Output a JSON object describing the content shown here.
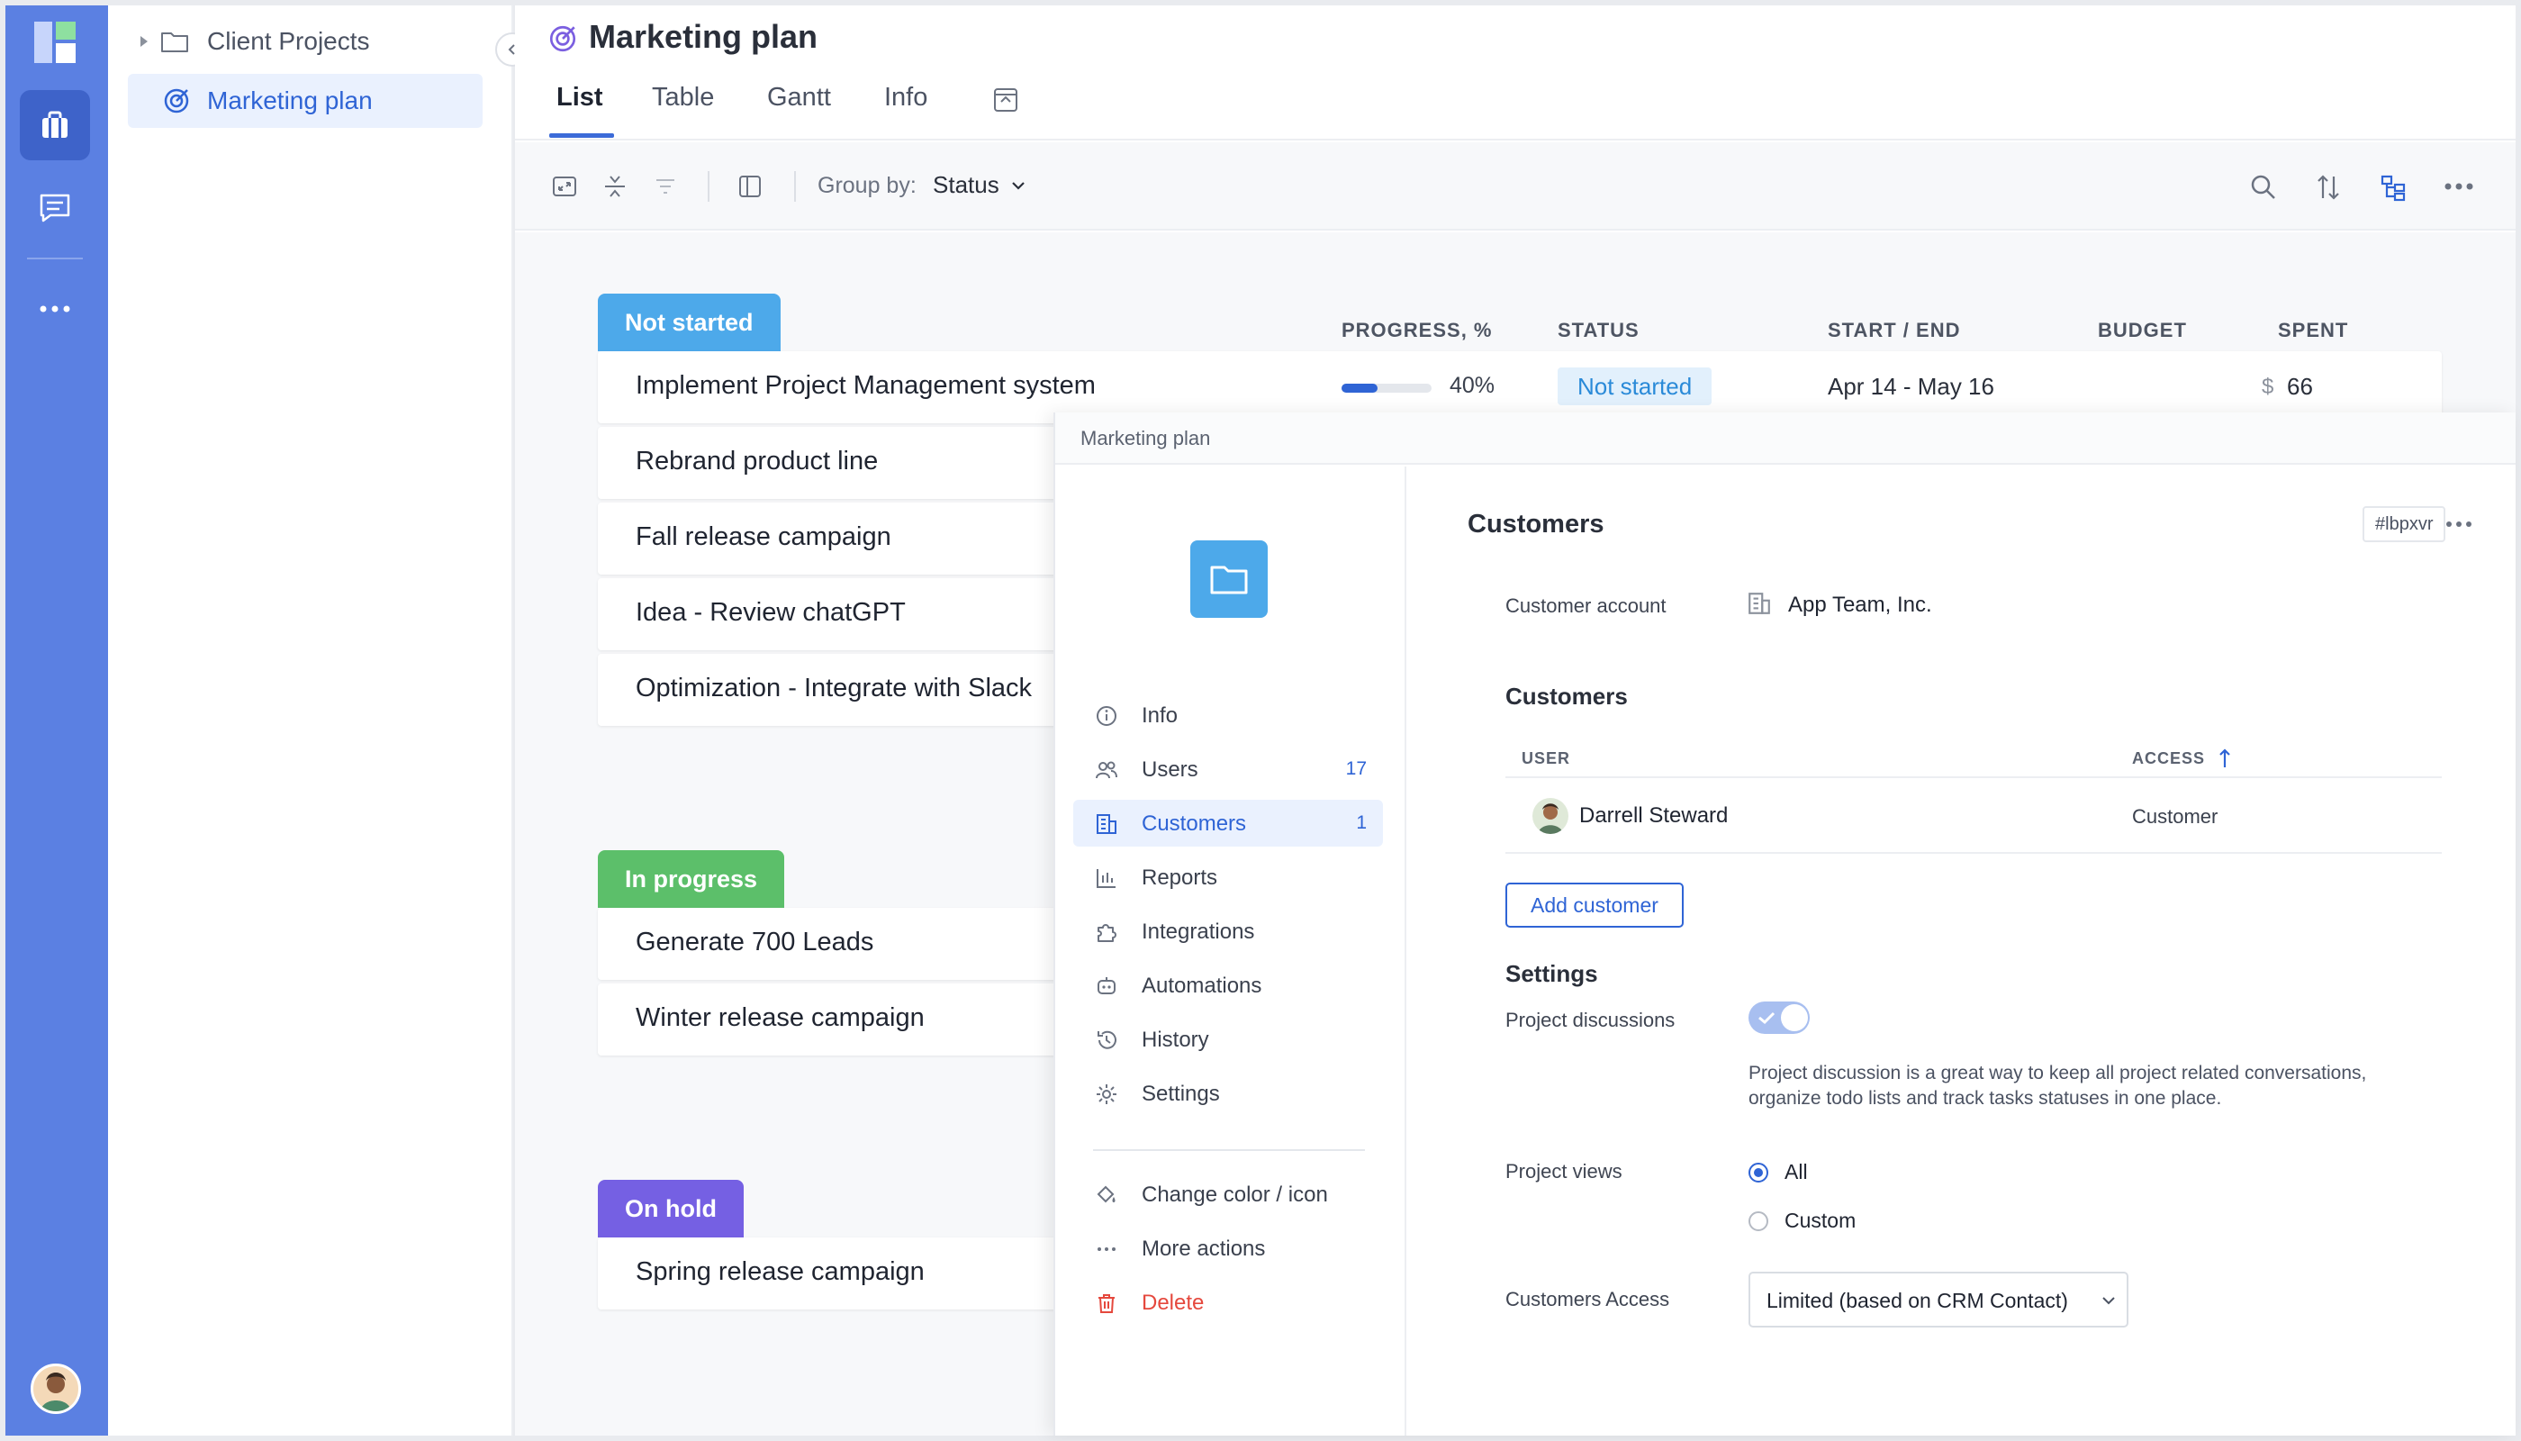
{
  "sidebar": {
    "folder_label": "Client Projects",
    "project_label": "Marketing plan"
  },
  "header": {
    "title": "Marketing plan",
    "tabs": [
      "List",
      "Table",
      "Gantt",
      "Info"
    ]
  },
  "toolbar": {
    "group_by_label": "Group by:",
    "group_by_value": "Status"
  },
  "table": {
    "columns": [
      "PROGRESS, %",
      "STATUS",
      "START / END",
      "BUDGET",
      "SPENT"
    ]
  },
  "groups": [
    {
      "label": "Not started",
      "color": "#4da9ea",
      "rows": [
        "Implement Project Management system",
        "Rebrand product line",
        "Fall release campaign",
        "Idea - Review chatGPT",
        "Optimization - Integrate with Slack"
      ]
    },
    {
      "label": "In progress",
      "color": "#5cbf6a",
      "rows": [
        "Generate 700 Leads",
        "Winter release campaign"
      ]
    },
    {
      "label": "On hold",
      "color": "#7560e3",
      "rows": [
        "Spring release campaign"
      ]
    }
  ],
  "first_row": {
    "progress": 0.4,
    "progress_text": "40%",
    "status": "Not started",
    "dates": "Apr 14 - May 16",
    "currency": "$",
    "spent": "66"
  },
  "panel": {
    "breadcrumb": "Marketing plan",
    "nav": [
      {
        "label": "Info",
        "icon": "info-icon"
      },
      {
        "label": "Users",
        "icon": "users-icon",
        "count": "17"
      },
      {
        "label": "Customers",
        "icon": "building-icon",
        "count": "1"
      },
      {
        "label": "Reports",
        "icon": "chart-icon"
      },
      {
        "label": "Integrations",
        "icon": "puzzle-icon"
      },
      {
        "label": "Automations",
        "icon": "robot-icon"
      },
      {
        "label": "History",
        "icon": "history-icon"
      },
      {
        "label": "Settings",
        "icon": "gear-icon"
      }
    ],
    "actions": [
      {
        "label": "Change color / icon",
        "icon": "paint-bucket-icon"
      },
      {
        "label": "More actions",
        "icon": "dots-icon"
      },
      {
        "label": "Delete",
        "icon": "trash-icon"
      }
    ],
    "body": {
      "title": "Customers",
      "id_badge": "#lbpxvr",
      "customer_account_label": "Customer account",
      "customer_account_value": "App Team, Inc.",
      "customers_title": "Customers",
      "user_col": "USER",
      "access_col": "ACCESS",
      "customer_name": "Darrell Steward",
      "customer_access": "Customer",
      "add_button": "Add customer",
      "settings_title": "Settings",
      "discussions_label": "Project discussions",
      "discussions_on": true,
      "discussions_desc_1": "Project discussion is a great way to keep all project related conversations,",
      "discussions_desc_2": "organize todo lists and track tasks statuses in one place.",
      "views_label": "Project views",
      "view_options": [
        "All",
        "Custom"
      ],
      "view_selected": "All",
      "access_label": "Customers Access",
      "access_value": "Limited (based on CRM Contact)"
    }
  },
  "colors": {
    "accent": "#2f64d5",
    "rail": "#5b80e2",
    "danger": "#e5483d"
  }
}
